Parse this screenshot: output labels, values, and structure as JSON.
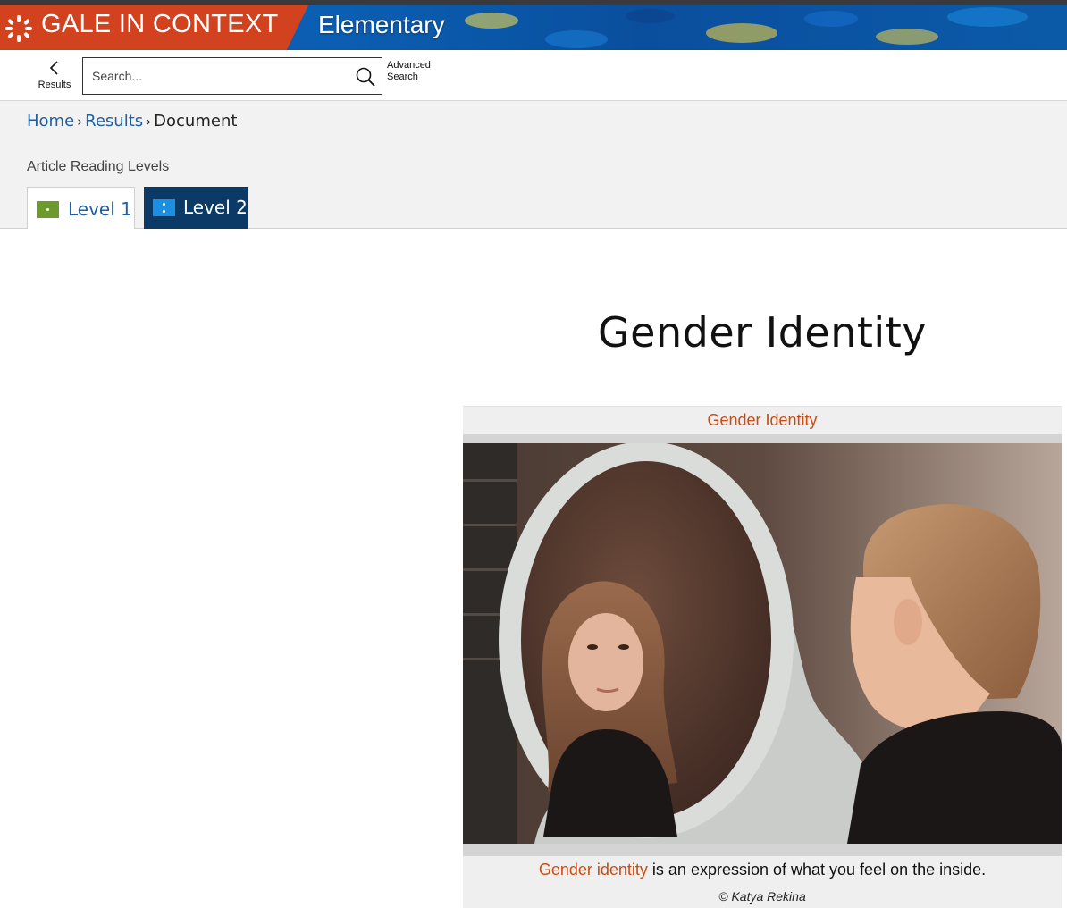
{
  "banner": {
    "brand": "GALE IN CONTEXT",
    "edition": "Elementary",
    "brand_color": "#d2421f",
    "banner_color": "#0b5fb3"
  },
  "toolbar": {
    "back_label": "Results",
    "search_placeholder": "Search...",
    "advanced_search_line1": "Advanced",
    "advanced_search_line2": "Search"
  },
  "breadcrumb": {
    "items": [
      "Home",
      "Results",
      "Document"
    ],
    "separator": "›"
  },
  "reading_levels": {
    "label": "Article Reading Levels",
    "tabs": [
      {
        "label": "Level 1",
        "selected": false,
        "color": "#6b9a2d"
      },
      {
        "label": "Level 2",
        "selected": true,
        "color": "#1b8fe0"
      }
    ]
  },
  "article": {
    "title": "Gender Identity",
    "figure": {
      "title": "Gender Identity",
      "caption_highlight": "Gender identity",
      "caption_rest": " is an expression of what you feel on the inside.",
      "credit": "© Katya Rekina",
      "accent_color": "#cc4a10"
    }
  }
}
